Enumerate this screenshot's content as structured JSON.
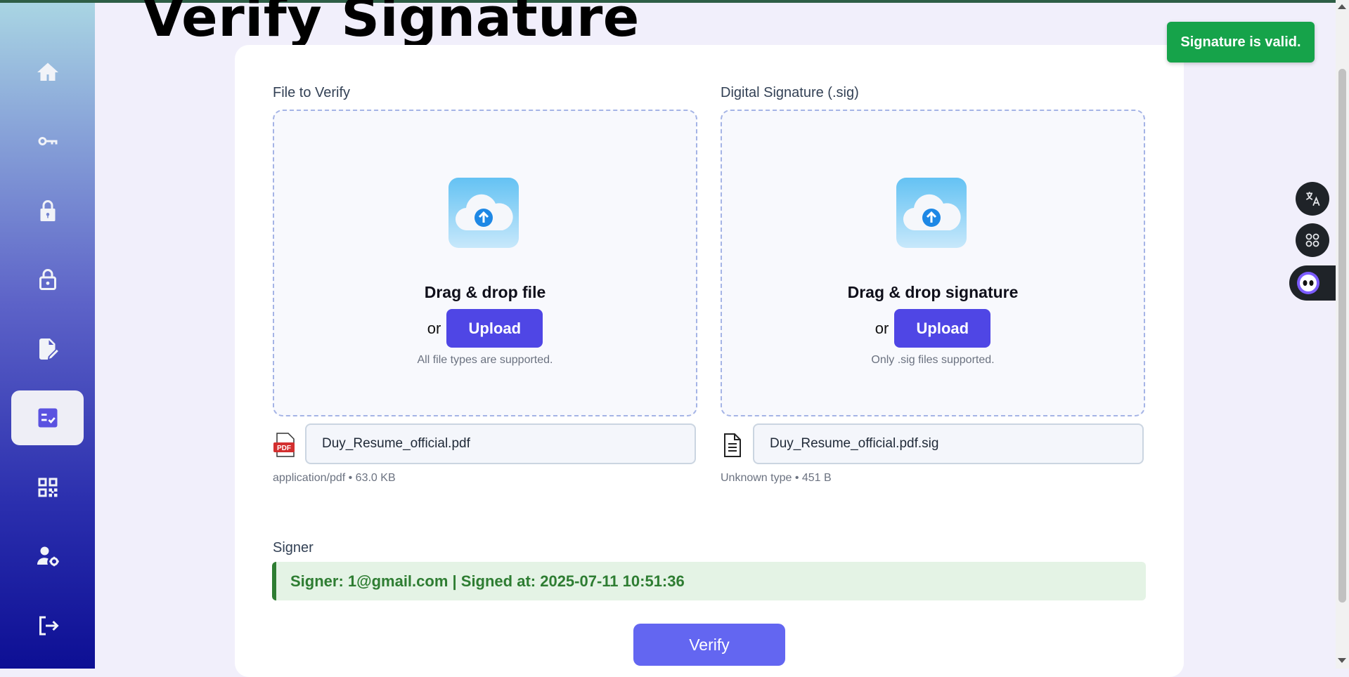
{
  "page": {
    "title": "Verify Signature"
  },
  "sidebar": {
    "items": [
      {
        "icon": "home-icon",
        "active": false
      },
      {
        "icon": "key-icon",
        "active": false
      },
      {
        "icon": "lock-icon",
        "active": false
      },
      {
        "icon": "unlock-icon",
        "active": false
      },
      {
        "icon": "file-sign-icon",
        "active": false
      },
      {
        "icon": "verify-checklist-icon",
        "active": true
      },
      {
        "icon": "qr-code-icon",
        "active": false
      },
      {
        "icon": "user-settings-icon",
        "active": false
      },
      {
        "icon": "logout-icon",
        "active": false
      }
    ]
  },
  "file_section": {
    "label": "File to Verify",
    "dropzone_title": "Drag & drop file",
    "or_text": "or",
    "upload_label": "Upload",
    "hint": "All file types are supported.",
    "file_name": "Duy_Resume_official.pdf",
    "file_meta": "application/pdf • 63.0 KB",
    "file_icon_text": "PDF"
  },
  "signature_section": {
    "label": "Digital Signature (.sig)",
    "dropzone_title": "Drag & drop signature",
    "or_text": "or",
    "upload_label": "Upload",
    "hint": "Only .sig files supported.",
    "file_name": "Duy_Resume_official.pdf.sig",
    "file_meta": "Unknown type • 451 B"
  },
  "signer": {
    "label": "Signer",
    "info": "Signer: 1@gmail.com | Signed at: 2025-07-11 10:51:36"
  },
  "verify_label": "Verify",
  "toast": "Signature is valid.",
  "floating": {
    "translate_icon": "translate-icon",
    "apps_icon": "apps-icon",
    "assistant_icon": "assistant-icon"
  },
  "colors": {
    "accent": "#4f46e5",
    "verify_button": "#6366f1",
    "success": "#16a34a",
    "signer_text": "#2e7d32",
    "signer_bg": "#e4f3e5"
  }
}
